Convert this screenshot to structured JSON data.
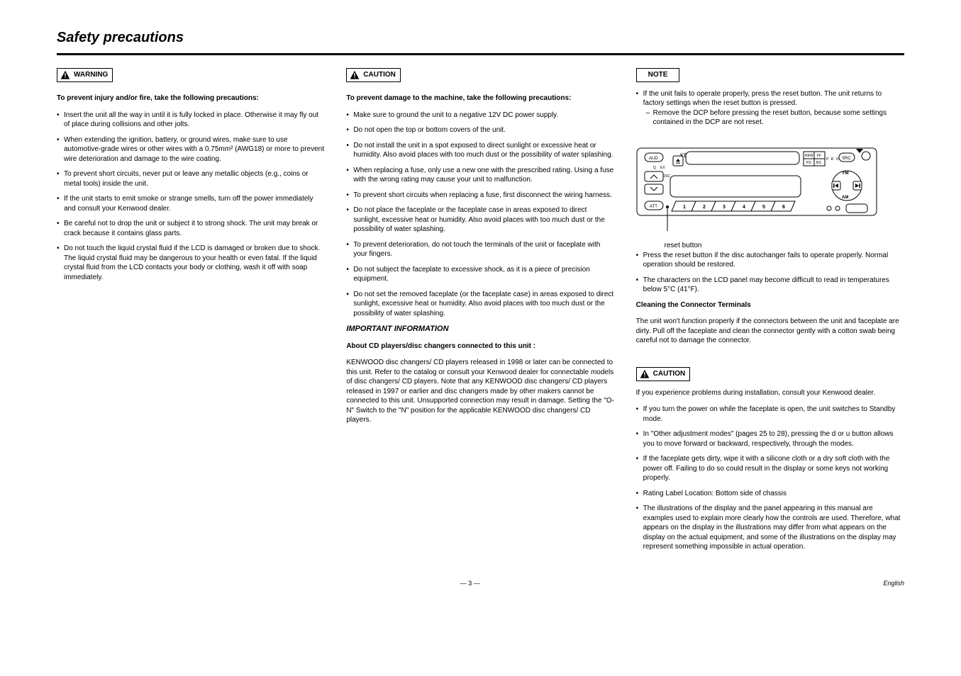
{
  "page_title": "Safety precautions",
  "warning_box_label": "WARNING",
  "caution_box_label": "CAUTION",
  "note_box_label": "NOTE",
  "caution_secondary_label": "CAUTION",
  "col1": {
    "lead": "To prevent injury and/or fire, take the following\nprecautions:",
    "items": [
      "Insert the unit all the way in until it is fully locked in place. Otherwise it may fly out of place during collisions and other jolts.",
      "When extending the ignition, battery, or ground wires, make sure to use automotive-grade wires or other wires with a 0.75mm² (AWG18) or more to prevent wire deterioration and damage to the wire coating.",
      "To prevent short circuits, never put or leave any metallic objects (e.g., coins or metal tools) inside the unit.",
      "If the unit starts to emit smoke or strange smells, turn off the power immediately and consult your Kenwood dealer.",
      "Be careful not to drop the unit or subject it to strong shock.\nThe unit may break or crack because it contains glass parts.",
      "Do not touch the liquid crystal fluid if the LCD is damaged or broken due to shock. The liquid crystal fluid may be dangerous to your health or even fatal.\nIf the liquid crystal fluid from the LCD contacts your body or clothing, wash it off with soap immediately."
    ]
  },
  "col2": {
    "lead": "To prevent damage to the machine, take the\nfollowing precautions:",
    "items": [
      "Make sure to ground the unit to a negative 12V DC power supply.",
      "Do not open the top or bottom covers of the unit.",
      "Do not install the unit in a spot exposed to direct sunlight or excessive heat or humidity. Also avoid places with too much dust or the possibility of water splashing.",
      "When replacing a fuse, only use a new one with the prescribed rating. Using a fuse with the wrong rating may cause your unit to malfunction.",
      "To prevent short circuits when replacing a fuse, first disconnect the wiring harness.",
      "Do not place the faceplate or the faceplate case in areas exposed to direct sunlight, excessive heat or humidity. Also avoid places with too much dust or the possibility of water splashing.",
      "To prevent deterioration, do not touch the terminals of the unit or faceplate with your fingers.",
      "Do not subject the faceplate to excessive shock, as it is a piece of precision equipment.",
      "Do not set the removed faceplate (or the faceplate case) in areas exposed to direct sunlight, excessive heat or humidity. Also avoid places with too much dust or the possibility of water splashing."
    ],
    "notes_h": "IMPORTANT INFORMATION",
    "note_block_title": "About CD players/disc changers connected to this unit :",
    "note_block_body": "KENWOOD disc changers/ CD players released in 1998 or later can be connected to this unit.\nRefer to the catalog or consult your Kenwood dealer for connectable models of disc changers/ CD players.\nNote that any KENWOOD disc changers/ CD players released in 1997 or earlier and disc changers made by other makers cannot be connected to this unit.\nUnsupported connection may result in damage.\nSetting the \"O-N\" Switch to the \"N\" position for the applicable KENWOOD disc changers/ CD players."
  },
  "col3": {
    "reset_para": "If the unit fails to operate properly, press the reset button. The unit returns to factory settings when the reset button is pressed.",
    "remove_dcp": "Remove the DCP before pressing the reset button, because some settings contained in the DCP are not reset.",
    "reset_label": "reset button",
    "after_items": [
      "Press the reset button if the disc autochanger fails to operate properly. Normal operation should be restored.",
      "The characters on the LCD panel may become difficult to read in temperatures below 5°C (41°F)."
    ],
    "cleaning_h": "Cleaning the Connector Terminals",
    "cleaning_body": "The unit won't function properly if the connectors between the unit and faceplate are dirty. Pull off the faceplate and clean the connector gently with a cotton swab being careful not to damage the connector.",
    "caution2_body": "If you experience problems during installation, consult your Kenwood dealer.",
    "notes2": [
      "If you turn the power on while the faceplate is open, the unit switches to Standby mode.",
      "In \"Other adjustment modes\" (pages 25 to 28), pressing the d or u button allows you to move forward or backward, respectively, through the modes.",
      "If the faceplate gets dirty, wipe it with a silicone cloth or a dry soft cloth with the power off. Failing to do so could result in the display or some keys not working properly.",
      "Rating Label Location: Bottom side of chassis",
      "The illustrations of the display and the panel appearing in this manual are examples used to explain more clearly how the controls are used. Therefore, what appears on the display in the illustrations may differ from what appears on the display on the actual equipment, and some of the illustrations on the display may represent something impossible in actual operation."
    ]
  },
  "footer": {
    "page_num": "— 3 —",
    "lang": "English"
  },
  "diagram": {
    "brand": "KENWOOD",
    "aud": "AUD",
    "q": "Q",
    "ex": "EX",
    "att": "ATT",
    "crsc": "CRSC",
    "rew": "REW",
    "ff": "FF",
    "ps": "PS",
    "bs": "BS",
    "prog": "P R O G",
    "src": "SRC",
    "fm": "FM",
    "am": "AM",
    "nums": [
      "1",
      "2",
      "3",
      "4",
      "5",
      "6"
    ]
  }
}
